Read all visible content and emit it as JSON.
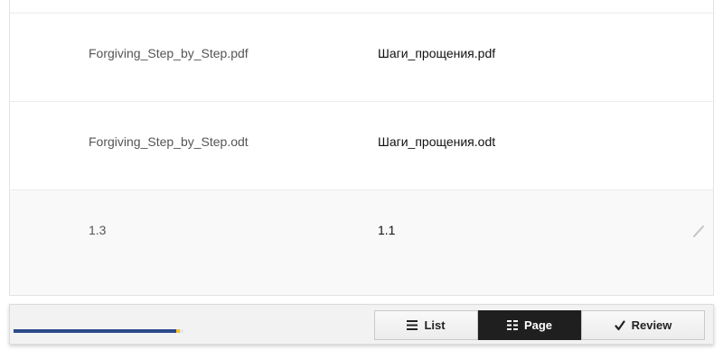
{
  "rows": [
    {
      "source": "Forgiving_Step_by_Step.pdf",
      "target": "Шаги_прощения.pdf"
    },
    {
      "source": "Forgiving_Step_by_Step.odt",
      "target": "Шаги_прощения.odt"
    },
    {
      "source": "1.3",
      "target": "1.1",
      "editable_icon": "pencil-icon"
    }
  ],
  "toolbar": {
    "progress": {
      "translated_fraction": 0.96,
      "fuzzy_fraction": 0.02,
      "colors": {
        "translated": "#2c4a8a",
        "fuzzy": "#f2c230"
      }
    },
    "buttons": [
      {
        "label": "List",
        "icon": "list-icon",
        "active": false
      },
      {
        "label": "Page",
        "icon": "grid-icon",
        "active": true
      },
      {
        "label": "Review",
        "icon": "check-icon",
        "active": false
      }
    ]
  }
}
